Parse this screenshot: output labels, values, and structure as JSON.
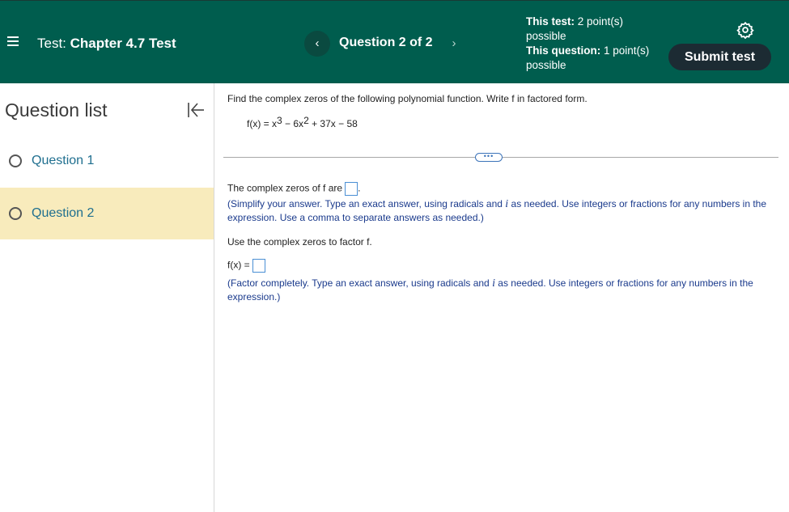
{
  "header": {
    "test_label": "Test:",
    "test_name": "Chapter 4.7 Test",
    "prev_icon": "‹",
    "question_nav": "Question 2 of 2",
    "next_icon": "›",
    "test_points_label": "This test:",
    "test_points_value": "2 point(s) possible",
    "question_points_label": "This question:",
    "question_points_value": "1 point(s) possible",
    "submit_label": "Submit test",
    "colors": {
      "bar": "#005d4e",
      "submit": "#1c2b33"
    }
  },
  "sidebar": {
    "title": "Question list",
    "items": [
      {
        "label": "Question 1",
        "selected": false
      },
      {
        "label": "Question 2",
        "selected": true
      }
    ],
    "selected_color": "#f8ebbc"
  },
  "question": {
    "instruction": "Find the complex zeros of the following polynomial function. Write f in factored form.",
    "formula": {
      "lhs": "f(x) = x",
      "exp1": "3",
      "mid": " − 6x",
      "exp2": "2",
      "rest": " + 37x − 58"
    },
    "more_label": "•••",
    "part1_prompt": "The complex zeros of f are",
    "part1_hint_a": "(Simplify your answer. Type an exact answer, using radicals and ",
    "hint_i": "i",
    "part1_hint_b": " as needed. Use integers or fractions for any numbers in the expression. Use a comma to separate answers as needed.)",
    "part2_prompt": "Use the complex zeros to factor f.",
    "part2_lhs": "f(x) =",
    "part2_hint_a": "(Factor completely. Type an exact answer, using radicals and ",
    "part2_hint_b": " as needed. Use integers or fractions for any numbers in the expression.)"
  }
}
